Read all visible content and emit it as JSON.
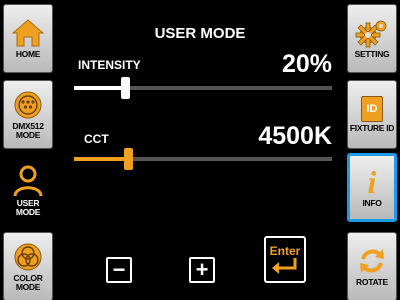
{
  "left_menu": {
    "home": {
      "label": "HOME"
    },
    "dmx": {
      "label": "DMX512 MODE"
    },
    "user": {
      "label": "USER MODE"
    },
    "color": {
      "label": "COLOR MODE"
    }
  },
  "right_menu": {
    "settings": {
      "label": "SETTING"
    },
    "fixture": {
      "label": "FIXTURE ID",
      "icon_text": "ID"
    },
    "info": {
      "label": "INFO",
      "icon_text": "i"
    },
    "rotate": {
      "label": "ROTATE"
    }
  },
  "main": {
    "title": "USER MODE",
    "intensity": {
      "label": "INTENSITY",
      "value": "20%",
      "level_percent": 20
    },
    "cct": {
      "label": "CCT",
      "value": "4500K",
      "level_percent": 21
    },
    "minus_label": "−",
    "plus_label": "+",
    "enter_label": "Enter"
  },
  "colors": {
    "accent_orange": "#f0a020",
    "selected_blue": "#1e9be6",
    "intensity_fill": "#ffffff",
    "cct_fill": "#f0a020"
  },
  "icons": {
    "home": "home-icon",
    "dmx": "dmx-icon",
    "user": "user-icon",
    "color": "color-wheel-icon",
    "settings": "gear-icon",
    "fixture": "id-card-icon",
    "info": "info-icon",
    "rotate": "rotate-icon",
    "enter": "enter-arrow-icon"
  }
}
